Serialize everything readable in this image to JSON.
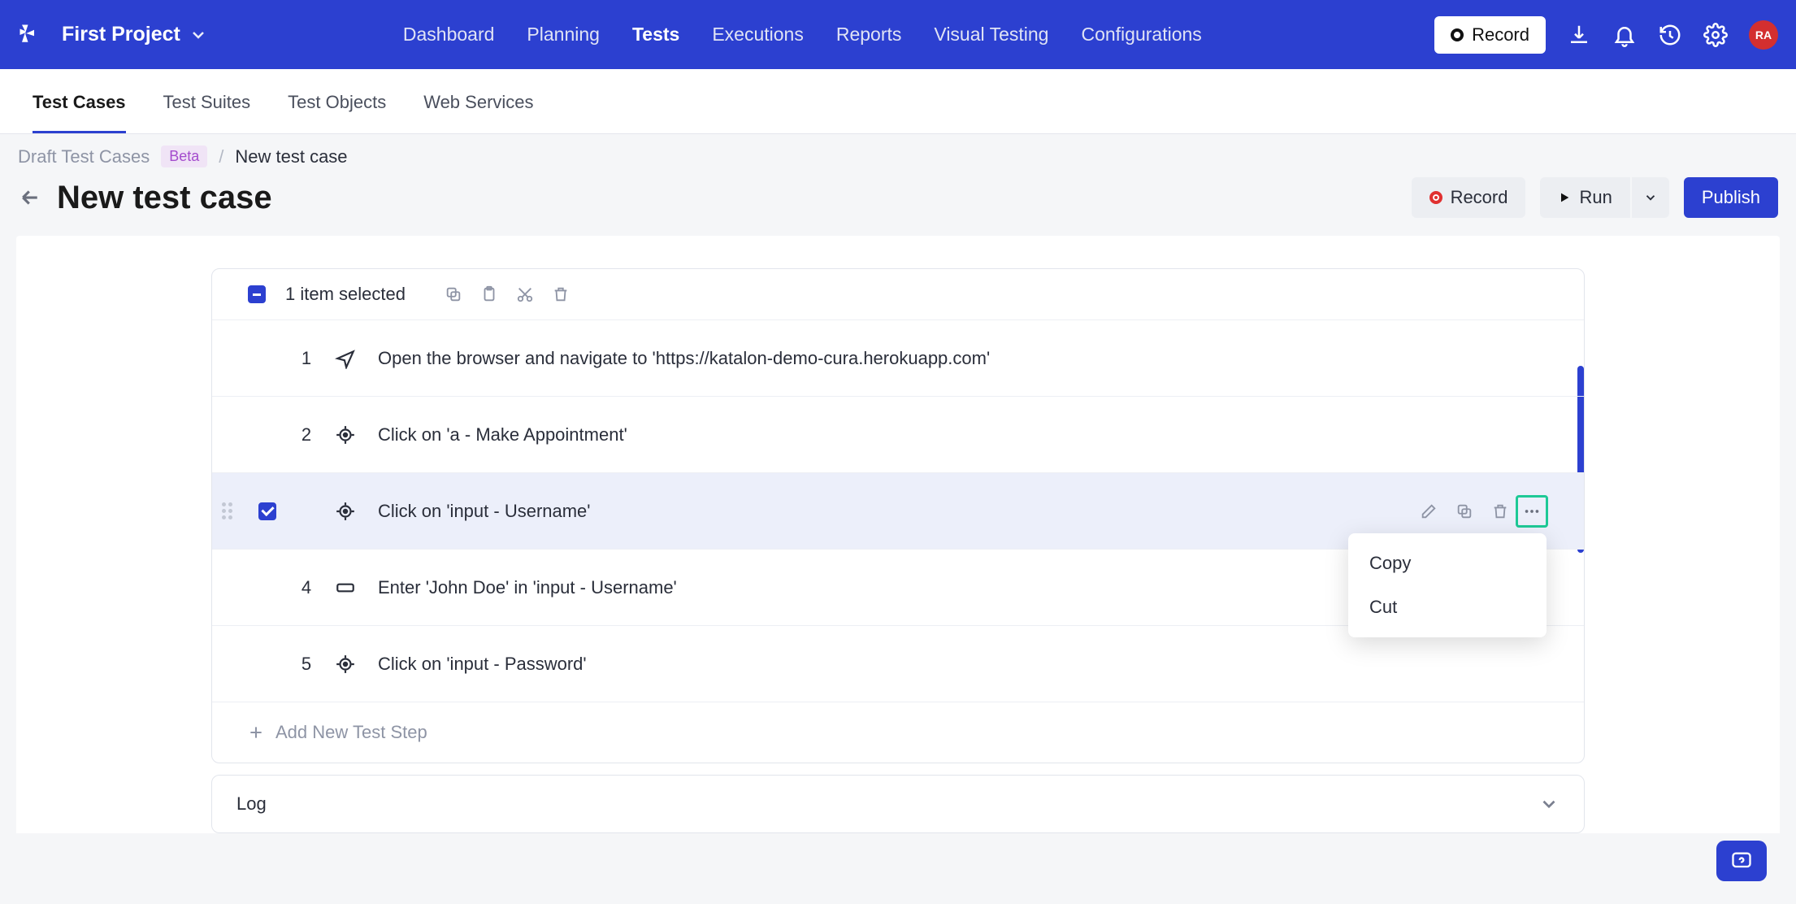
{
  "top": {
    "project": "First Project",
    "nav": [
      "Dashboard",
      "Planning",
      "Tests",
      "Executions",
      "Reports",
      "Visual Testing",
      "Configurations"
    ],
    "active_nav": "Tests",
    "record": "Record",
    "avatar": "RA"
  },
  "subtabs": {
    "items": [
      "Test Cases",
      "Test Suites",
      "Test Objects",
      "Web Services"
    ],
    "active": "Test Cases"
  },
  "breadcrumb": {
    "root": "Draft Test Cases",
    "badge": "Beta",
    "current": "New test case"
  },
  "title": "New test case",
  "toolbar": {
    "record": "Record",
    "run": "Run",
    "publish": "Publish"
  },
  "selection": {
    "label": "1 item selected"
  },
  "steps": [
    {
      "num": "1",
      "icon": "navigate",
      "text": "Open the browser and navigate to 'https://katalon-demo-cura.herokuapp.com'"
    },
    {
      "num": "2",
      "icon": "click",
      "text": "Click on 'a - Make Appointment'"
    },
    {
      "num": "",
      "icon": "click",
      "text": "Click on 'input - Username'",
      "selected": true,
      "checked": true,
      "showRowActions": true,
      "showMore": true,
      "showDrag": true
    },
    {
      "num": "4",
      "icon": "input",
      "text": "Enter 'John Doe' in 'input - Username'"
    },
    {
      "num": "5",
      "icon": "click",
      "text": "Click on 'input - Password'"
    }
  ],
  "dropdown": {
    "items": [
      "Copy",
      "Cut"
    ]
  },
  "add_step": "Add New Test Step",
  "log": "Log"
}
